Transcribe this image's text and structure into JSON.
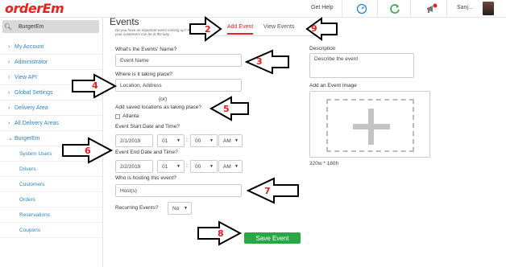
{
  "brand": {
    "logo": "orderEm"
  },
  "topbar": {
    "get_help": "Get Help",
    "user_name": "Sanj..."
  },
  "sidebar": {
    "search_text": "BurgerEm",
    "items": [
      {
        "label": "My Account"
      },
      {
        "label": "Administrator"
      },
      {
        "label": "View API"
      },
      {
        "label": "Global Settings"
      },
      {
        "label": "Delivery Area"
      },
      {
        "label": "All Delivery Areas"
      },
      {
        "label": "BurgerEm"
      }
    ],
    "sub_items": [
      {
        "label": "System Users"
      },
      {
        "label": "Drivers"
      },
      {
        "label": "Customers"
      },
      {
        "label": "Orders"
      },
      {
        "label": "Reservations"
      },
      {
        "label": "Coupons"
      }
    ]
  },
  "page": {
    "title": "Events",
    "subtitle": "Do you have an important event coming up? Post it here so all your customers can be in the loop",
    "tabs": [
      {
        "label": "Add Event"
      },
      {
        "label": "View Events"
      }
    ]
  },
  "form": {
    "event_name_label": "What's the Events' Name?",
    "event_name_value": "Event Name",
    "location_label": "Where is it taking place?",
    "location_value": "Location, Address",
    "or_text": "(or)",
    "saved_locations_label": "Add saved locations as taking place?",
    "saved_location_option": "Atlanta",
    "start_label": "Event Start Date and Time?",
    "start_date": "2/1/2019",
    "start_hour": "01",
    "start_minute": "00",
    "start_ampm": "AM",
    "end_label": "Event End Date and Time?",
    "end_date": "2/2/2019",
    "end_hour": "01",
    "end_minute": "00",
    "end_ampm": "AM",
    "host_label": "Who is hosting this event?",
    "host_value": "Host(s)",
    "recurring_label": "Recurring Events?",
    "recurring_value": "No",
    "description_label": "Description",
    "description_value": "Describe the event",
    "image_label": "Add an Event Image",
    "image_size": "320w * 180h",
    "save_label": "Save Event"
  },
  "annotations": [
    "2",
    "3",
    "4",
    "5",
    "6",
    "7",
    "8",
    "9"
  ],
  "colors": {
    "brand_red": "#e8231f",
    "link_blue": "#2b86c5",
    "save_green": "#28a745",
    "annotation_red": "#e41e1e"
  }
}
